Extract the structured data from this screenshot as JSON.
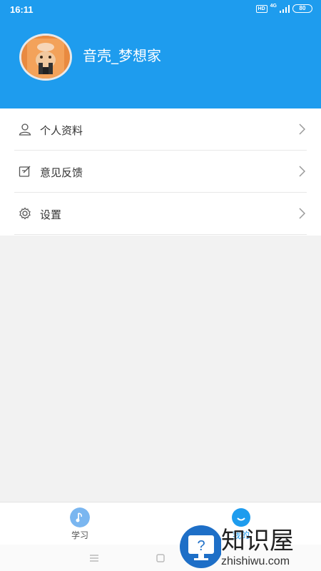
{
  "status_bar": {
    "time": "16:11",
    "hd": "HD",
    "network": "4G",
    "battery": "80"
  },
  "profile": {
    "username": "音壳_梦想家",
    "avatar_icon": "avatar-photo"
  },
  "menu": {
    "items": [
      {
        "label": "个人资料",
        "icon": "person-icon"
      },
      {
        "label": "意见反馈",
        "icon": "feedback-edit-icon"
      },
      {
        "label": "设置",
        "icon": "gear-icon"
      }
    ]
  },
  "tabs": [
    {
      "label": "学习",
      "icon": "music-note-icon",
      "active": false
    },
    {
      "label": "我的",
      "icon": "smile-icon",
      "active": true
    }
  ],
  "watermark": {
    "text": "知识屋",
    "sub": "zhishiwu.com"
  },
  "colors": {
    "header_bg": "#1e9cee",
    "tab_active": "#1e9cee",
    "tab_inactive_icon": "#7ab6f0"
  }
}
